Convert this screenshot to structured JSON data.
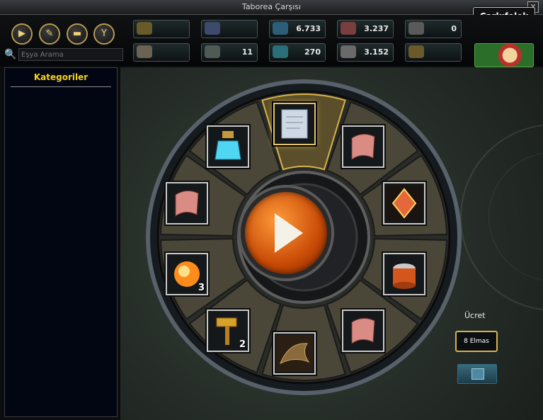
{
  "window": {
    "title": "Taborea Çarşısı",
    "tab": "Çarkıfelek",
    "close_glyph": "✕"
  },
  "toolbar": {
    "icons": [
      {
        "name": "play-icon",
        "glyph": "▶"
      },
      {
        "name": "scroll-icon",
        "glyph": "✎"
      },
      {
        "name": "ticket-icon",
        "glyph": "▬"
      },
      {
        "name": "filter-icon",
        "glyph": "Y"
      }
    ]
  },
  "search": {
    "placeholder": "Eşya Arama",
    "icon": "search-icon"
  },
  "currencies": [
    {
      "name": "currency-1",
      "value": ""
    },
    {
      "name": "currency-2",
      "value": ""
    },
    {
      "name": "currency-3",
      "value": "6.733"
    },
    {
      "name": "currency-4",
      "value": "3.237"
    },
    {
      "name": "currency-5",
      "value": "0"
    },
    {
      "name": "currency-6",
      "value": ""
    },
    {
      "name": "currency-7",
      "value": "11"
    },
    {
      "name": "currency-8",
      "value": "270"
    },
    {
      "name": "currency-9",
      "value": "3.152"
    },
    {
      "name": "currency-10",
      "value": ""
    }
  ],
  "sidebar": {
    "title": "Kategoriler"
  },
  "wheel": {
    "slots": [
      {
        "name": "scroll-item",
        "qty": ""
      },
      {
        "name": "rose-scroll-item",
        "qty": ""
      },
      {
        "name": "crystal-gem-item",
        "qty": ""
      },
      {
        "name": "pottery-item",
        "qty": ""
      },
      {
        "name": "rose-scroll-item",
        "qty": ""
      },
      {
        "name": "dragon-head-item",
        "qty": ""
      },
      {
        "name": "hammer-item",
        "qty": "2"
      },
      {
        "name": "orb-item",
        "qty": "3"
      },
      {
        "name": "rose-scroll-item",
        "qty": ""
      },
      {
        "name": "potion-item",
        "qty": ""
      }
    ]
  },
  "fee": {
    "label": "Ücret",
    "value": "8 Elmas"
  }
}
